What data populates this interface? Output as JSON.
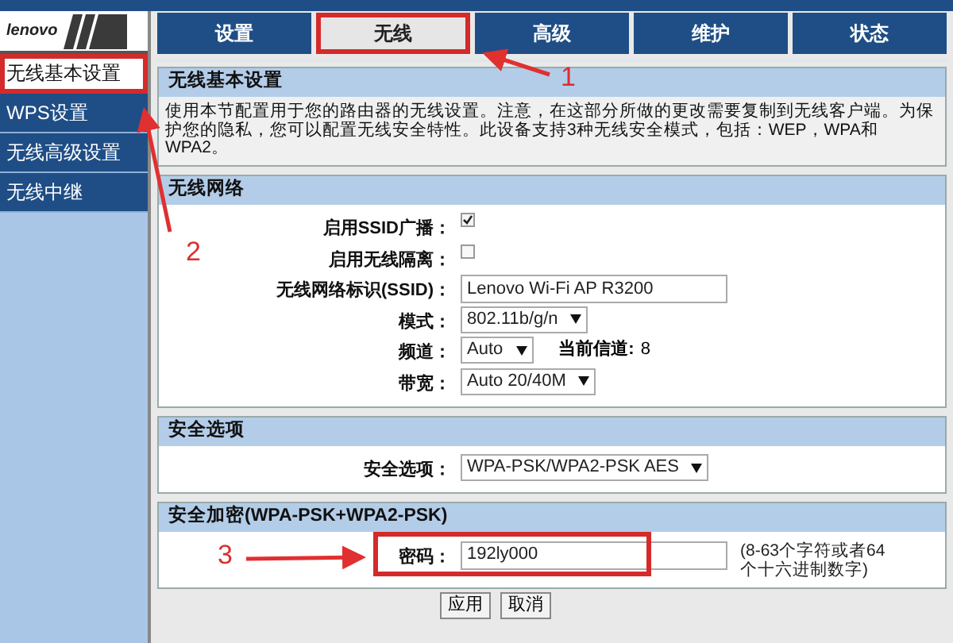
{
  "logo": "lenovo",
  "tabs": [
    {
      "label": "设置",
      "selected": false,
      "highlighted": false
    },
    {
      "label": "无线",
      "selected": true,
      "highlighted": true
    },
    {
      "label": "高级",
      "selected": false,
      "highlighted": false
    },
    {
      "label": "维护",
      "selected": false,
      "highlighted": false
    },
    {
      "label": "状态",
      "selected": false,
      "highlighted": false
    }
  ],
  "sidebar": {
    "items": [
      {
        "label": "无线基本设置",
        "selected": true,
        "highlighted": true
      },
      {
        "label": "WPS设置",
        "selected": false,
        "highlighted": false
      },
      {
        "label": "无线高级设置",
        "selected": false,
        "highlighted": false
      },
      {
        "label": "无线中继",
        "selected": false,
        "highlighted": false
      }
    ]
  },
  "sections": [
    {
      "title": "无线基本设置",
      "kind": "text",
      "text": "使用本节配置用于您的路由器的无线设置。注意，在这部分所做的更改需要复制到无线客户端。为保护您的隐私，您可以配置无线安全特性。此设备支持3种无线安全模式，包括：WEP，WPA和WPA2。"
    },
    {
      "title": "无线网络",
      "kind": "form",
      "rows": [
        {
          "kind": "checkbox",
          "label": "启用SSID广播：",
          "checked": true
        },
        {
          "kind": "checkbox",
          "label": "启用无线隔离：",
          "checked": false
        },
        {
          "kind": "input",
          "label": "无线网络标识(SSID)：",
          "value": "Lenovo Wi-Fi AP R3200"
        },
        {
          "kind": "select",
          "label": "模式：",
          "value": "802.11b/g/n"
        },
        {
          "kind": "select",
          "label": "频道：",
          "value": "Auto",
          "extra_label": "当前信道:",
          "extra_value": "8"
        },
        {
          "kind": "select",
          "label": "带宽：",
          "value": "Auto 20/40M"
        }
      ]
    },
    {
      "title": "安全选项",
      "kind": "form",
      "rows": [
        {
          "kind": "select",
          "label": "安全选项：",
          "value": "WPA-PSK/WPA2-PSK AES"
        }
      ]
    },
    {
      "title": "安全加密(WPA-PSK+WPA2-PSK)",
      "kind": "form",
      "rows": [
        {
          "kind": "input",
          "label": "密码：",
          "value": "192ly000",
          "hint": "(8-63个字符或者64个十六进制数字)",
          "highlighted": true
        }
      ]
    }
  ],
  "buttons": [
    "应用",
    "取消"
  ],
  "annotations": [
    {
      "number": "1"
    },
    {
      "number": "2"
    },
    {
      "number": "3"
    }
  ]
}
